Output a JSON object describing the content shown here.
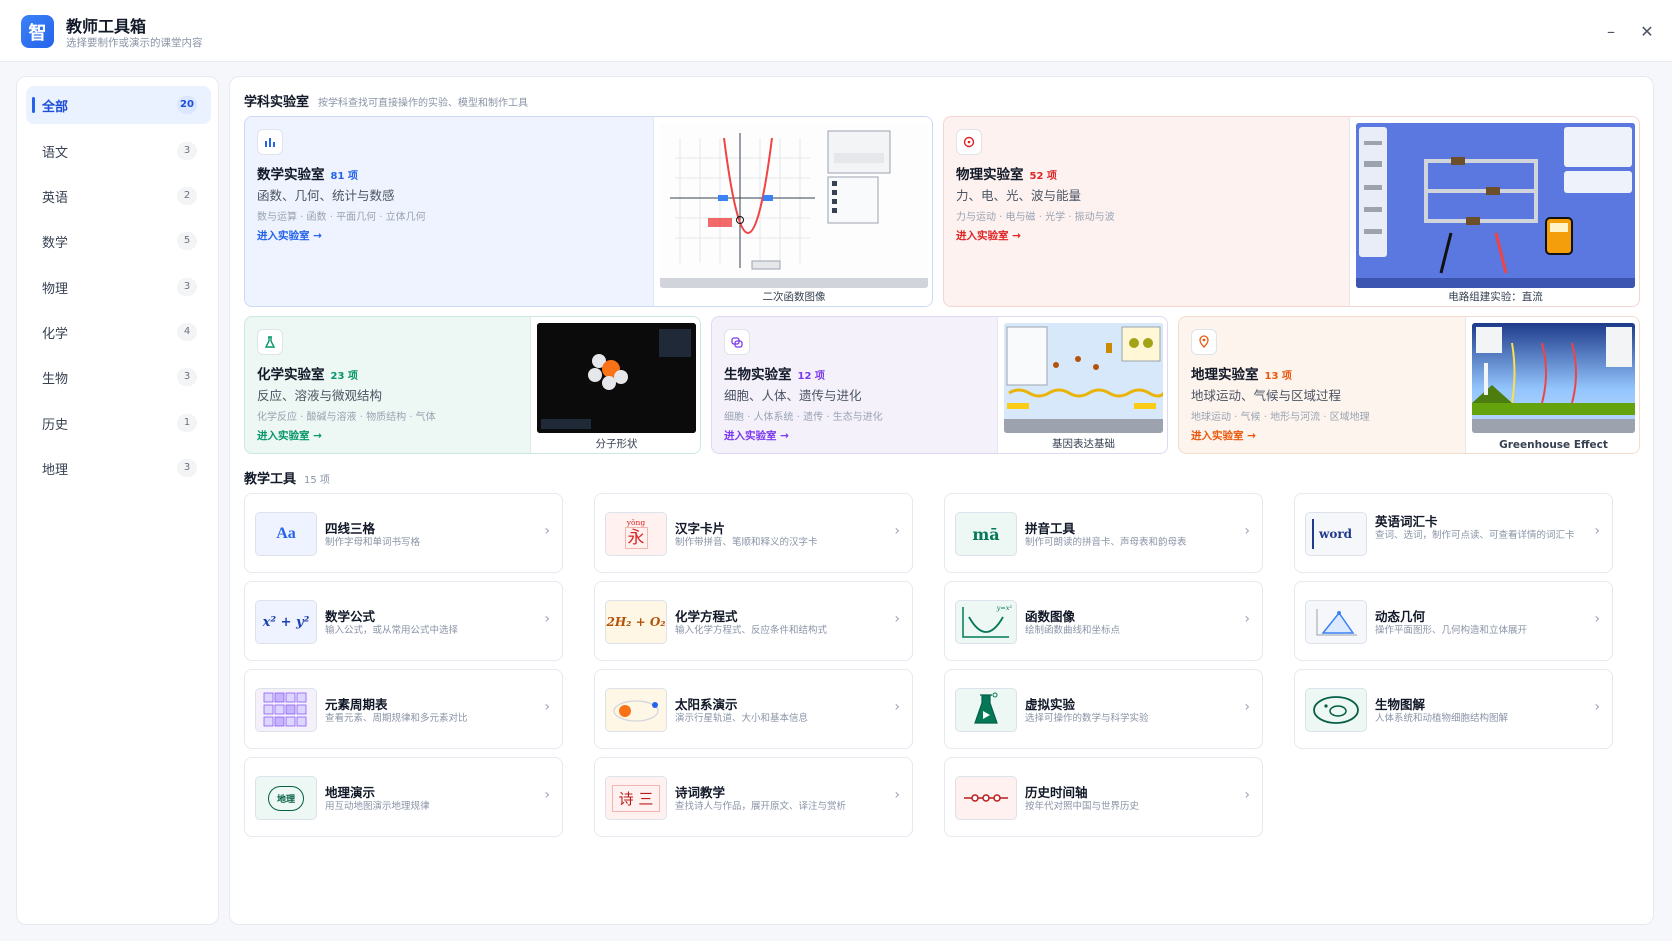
{
  "app": {
    "logo_char": "智",
    "title": "教师工具箱",
    "subtitle": "选择要制作或演示的课堂内容"
  },
  "window_controls": {
    "minimize": "–",
    "close": "✕"
  },
  "sidebar": {
    "items": [
      {
        "label": "全部",
        "count": "20",
        "active": true
      },
      {
        "label": "语文",
        "count": "3"
      },
      {
        "label": "英语",
        "count": "2"
      },
      {
        "label": "数学",
        "count": "5"
      },
      {
        "label": "物理",
        "count": "3"
      },
      {
        "label": "化学",
        "count": "4"
      },
      {
        "label": "生物",
        "count": "3"
      },
      {
        "label": "历史",
        "count": "1"
      },
      {
        "label": "地理",
        "count": "3"
      }
    ]
  },
  "labs_section": {
    "title": "学科实验室",
    "subtitle": "按学科查找可直接操作的实验、模型和制作工具"
  },
  "labs": [
    {
      "name": "数学实验室",
      "count": "81 项",
      "desc": "函数、几何、统计与数感",
      "tags": "数与运算 · 函数 · 平面几何 · 立体几何",
      "link": "进入实验室 →",
      "caption": "二次函数图像",
      "accent": "#2563eb",
      "icon": "bar-chart-icon"
    },
    {
      "name": "物理实验室",
      "count": "52 项",
      "desc": "力、电、光、波与能量",
      "tags": "力与运动 · 电与磁 · 光学 · 振动与波",
      "link": "进入实验室 →",
      "caption": "电路组建实验：直流",
      "accent": "#dc2626",
      "icon": "atom-icon"
    },
    {
      "name": "化学实验室",
      "count": "23 项",
      "desc": "反应、溶液与微观结构",
      "tags": "化学反应 · 酸碱与溶液 · 物质结构 · 气体",
      "link": "进入实验室 →",
      "caption": "分子形状",
      "accent": "#059669",
      "icon": "flask-icon"
    },
    {
      "name": "生物实验室",
      "count": "12 项",
      "desc": "细胞、人体、遗传与进化",
      "tags": "细胞 · 人体系统 · 遗传 · 生态与进化",
      "link": "进入实验室 →",
      "caption": "基因表达基础",
      "accent": "#7c3aed",
      "icon": "cell-icon"
    },
    {
      "name": "地理实验室",
      "count": "13 项",
      "desc": "地球运动、气候与区域过程",
      "tags": "地球运动 · 气候 · 地形与河流 · 区域地理",
      "link": "进入实验室 →",
      "caption": "Greenhouse Effect",
      "accent": "#ea580c",
      "icon": "map-pin-icon"
    }
  ],
  "tools_section": {
    "title": "教学工具",
    "count": "15 项"
  },
  "tools": [
    {
      "name": "四线三格",
      "desc": "制作字母和单词书写格",
      "glyph": "Aa"
    },
    {
      "name": "汉字卡片",
      "desc": "制作带拼音、笔顺和释义的汉字卡",
      "glyph": "永",
      "sup": "yǒng"
    },
    {
      "name": "拼音工具",
      "desc": "制作可朗读的拼音卡、声母表和韵母表",
      "glyph": "mā"
    },
    {
      "name": "英语词汇卡",
      "desc": "查词、选词，制作可点读、可查看详情的词汇卡",
      "glyph": "word"
    },
    {
      "name": "数学公式",
      "desc": "输入公式，或从常用公式中选择",
      "glyph": "x² + y²"
    },
    {
      "name": "化学方程式",
      "desc": "输入化学方程式、反应条件和结构式",
      "glyph": "2H₂ + O₂"
    },
    {
      "name": "函数图像",
      "desc": "绘制函数曲线和坐标点",
      "glyph": "y=x²"
    },
    {
      "name": "动态几何",
      "desc": "操作平面图形、几何构造和立体展开",
      "glyph": ""
    },
    {
      "name": "元素周期表",
      "desc": "查看元素、周期规律和多元素对比",
      "glyph": ""
    },
    {
      "name": "太阳系演示",
      "desc": "演示行星轨道、大小和基本信息",
      "glyph": ""
    },
    {
      "name": "虚拟实验",
      "desc": "选择可操作的数学与科学实验",
      "glyph": ""
    },
    {
      "name": "生物图解",
      "desc": "人体系统和动植物细胞结构图解",
      "glyph": ""
    },
    {
      "name": "地理演示",
      "desc": "用互动地图演示地理规律",
      "glyph": "地理"
    },
    {
      "name": "诗词教学",
      "desc": "查找诗人与作品，展开原文、译注与赏析",
      "glyph": "诗 三"
    },
    {
      "name": "历史时间轴",
      "desc": "按年代对照中国与世界历史",
      "glyph": ""
    }
  ]
}
